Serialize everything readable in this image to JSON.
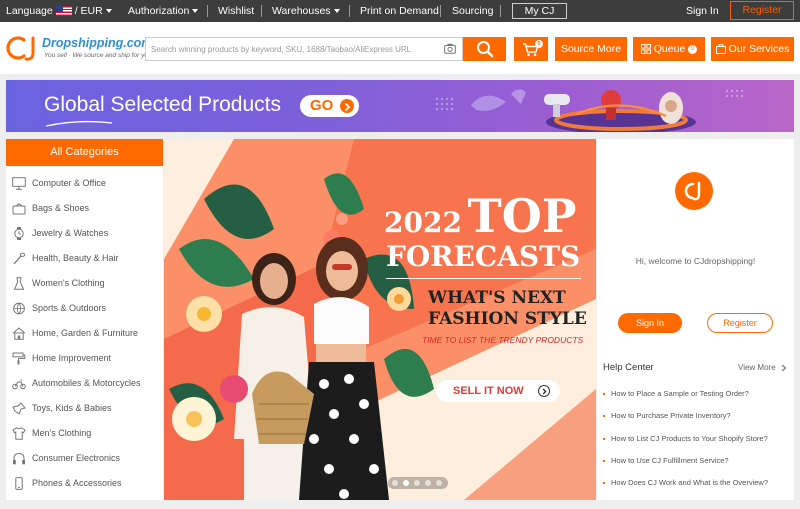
{
  "topbar": {
    "language_label": "Language",
    "currency": "/ EUR",
    "authorization": "Authorization",
    "wishlist": "Wishlist",
    "warehouses": "Warehouses",
    "print_on_demand": "Print on Demand",
    "sourcing": "Sourcing",
    "my_cj": "My CJ",
    "sign_in": "Sign In",
    "register": "Register"
  },
  "header": {
    "logo_name": "Dropshipping.com",
    "logo_tagline": "You sell · We source and ship for you!",
    "search_placeholder": "Search winning products by keyword, SKU, 1688/Taobao/AliExpress URL",
    "cart_count": "0",
    "source_more": "Source More",
    "queue": "Queue",
    "queue_count": "0",
    "our_services": "Our Services"
  },
  "promo": {
    "title": "Global Selected Products",
    "go": "GO"
  },
  "categories": {
    "heading": "All Categories",
    "items": [
      {
        "label": "Computer & Office",
        "icon": "monitor-icon"
      },
      {
        "label": "Bags & Shoes",
        "icon": "bag-icon"
      },
      {
        "label": "Jewelry & Watches",
        "icon": "watch-icon"
      },
      {
        "label": "Health, Beauty & Hair",
        "icon": "brush-icon"
      },
      {
        "label": "Women's Clothing",
        "icon": "dress-icon"
      },
      {
        "label": "Sports & Outdoors",
        "icon": "ball-icon"
      },
      {
        "label": "Home, Garden & Furniture",
        "icon": "house-icon"
      },
      {
        "label": "Home Improvement",
        "icon": "paint-roller-icon"
      },
      {
        "label": "Automobiles & Motorcycles",
        "icon": "motorcycle-icon"
      },
      {
        "label": "Toys, Kids & Babies",
        "icon": "toy-icon"
      },
      {
        "label": "Men's Clothing",
        "icon": "shirt-icon"
      },
      {
        "label": "Consumer Electronics",
        "icon": "headphones-icon"
      },
      {
        "label": "Phones & Accessories",
        "icon": "phone-icon"
      }
    ]
  },
  "hero": {
    "year": "2022",
    "top": "TOP",
    "forecasts": "FORECASTS",
    "whats_next": "WHAT'S NEXT",
    "fashion_style": "FASHION STYLE",
    "subtitle": "TIME TO LIST THE TRENDY PRODUCTS",
    "cta": "SELL IT NOW",
    "slides": 5,
    "active_slide": 1
  },
  "account": {
    "avatar_text": "cj",
    "welcome": "Hi, welcome to CJdropshipping!",
    "sign_in": "Sign In",
    "register": "Register"
  },
  "help": {
    "title": "Help Center",
    "view_more": "View More",
    "items": [
      "How to Place a Sample or Testing Order?",
      "How to Purchase Private Inventory?",
      "How to List CJ Products to Your Shopify Store?",
      "How to Use CJ Fulfillment Service?",
      "How Does CJ Work and What is the Overview?"
    ]
  },
  "colors": {
    "brand_orange": "#ff6a00",
    "topbar_bg": "#3d3d3d",
    "logo_blue": "#2c8fd8"
  }
}
